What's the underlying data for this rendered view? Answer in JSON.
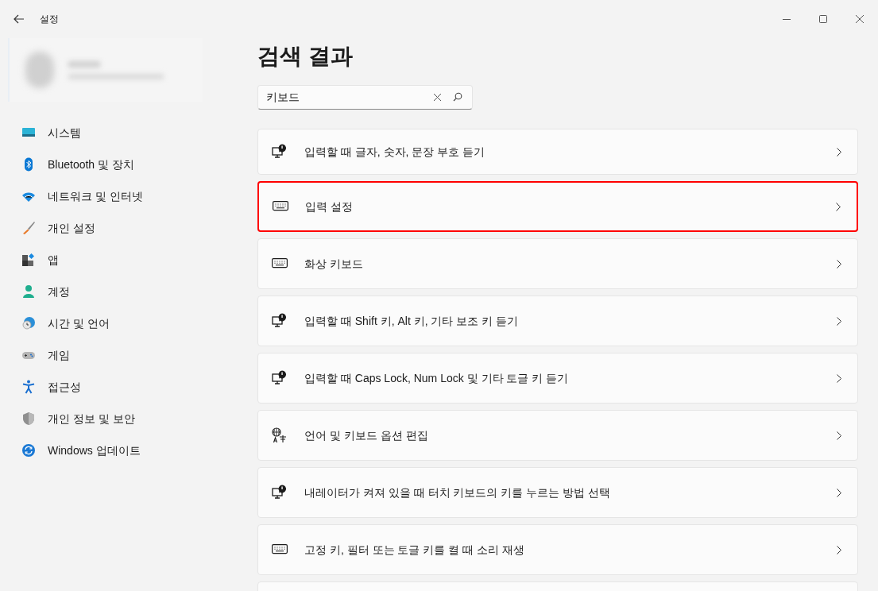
{
  "window": {
    "title": "설정"
  },
  "page_title": "검색 결과",
  "search": {
    "value": "키보드"
  },
  "sidebar": {
    "items": [
      {
        "label": "시스템",
        "kind": "system"
      },
      {
        "label": "Bluetooth 및 장치",
        "kind": "bluetooth"
      },
      {
        "label": "네트워크 및 인터넷",
        "kind": "network"
      },
      {
        "label": "개인 설정",
        "kind": "brush"
      },
      {
        "label": "앱",
        "kind": "apps"
      },
      {
        "label": "계정",
        "kind": "account"
      },
      {
        "label": "시간 및 언어",
        "kind": "time"
      },
      {
        "label": "게임",
        "kind": "game"
      },
      {
        "label": "접근성",
        "kind": "accessibility"
      },
      {
        "label": "개인 정보 및 보안",
        "kind": "shield"
      },
      {
        "label": "Windows 업데이트",
        "kind": "update"
      }
    ]
  },
  "results": [
    {
      "label": "입력할 때 글자, 숫자, 문장 부호 듣기",
      "kind": "narrator",
      "highlighted": false
    },
    {
      "label": "입력 설정",
      "kind": "keyboard",
      "highlighted": true
    },
    {
      "label": "화상 키보드",
      "kind": "keyboard",
      "highlighted": false
    },
    {
      "label": "입력할 때 Shift 키, Alt 키, 기타 보조 키 듣기",
      "kind": "narrator",
      "highlighted": false
    },
    {
      "label": "입력할 때 Caps Lock, Num Lock 및 기타 토글 키 듣기",
      "kind": "narrator",
      "highlighted": false
    },
    {
      "label": "언어 및 키보드 옵션 편집",
      "kind": "language",
      "highlighted": false
    },
    {
      "label": "내레이터가 켜져 있을 때 터치 키보드의 키를 누르는 방법 선택",
      "kind": "narrator",
      "highlighted": false
    },
    {
      "label": "고정 키, 필터 또는 토글 키를 켤 때 소리 재생",
      "kind": "keyboard",
      "highlighted": false
    }
  ]
}
